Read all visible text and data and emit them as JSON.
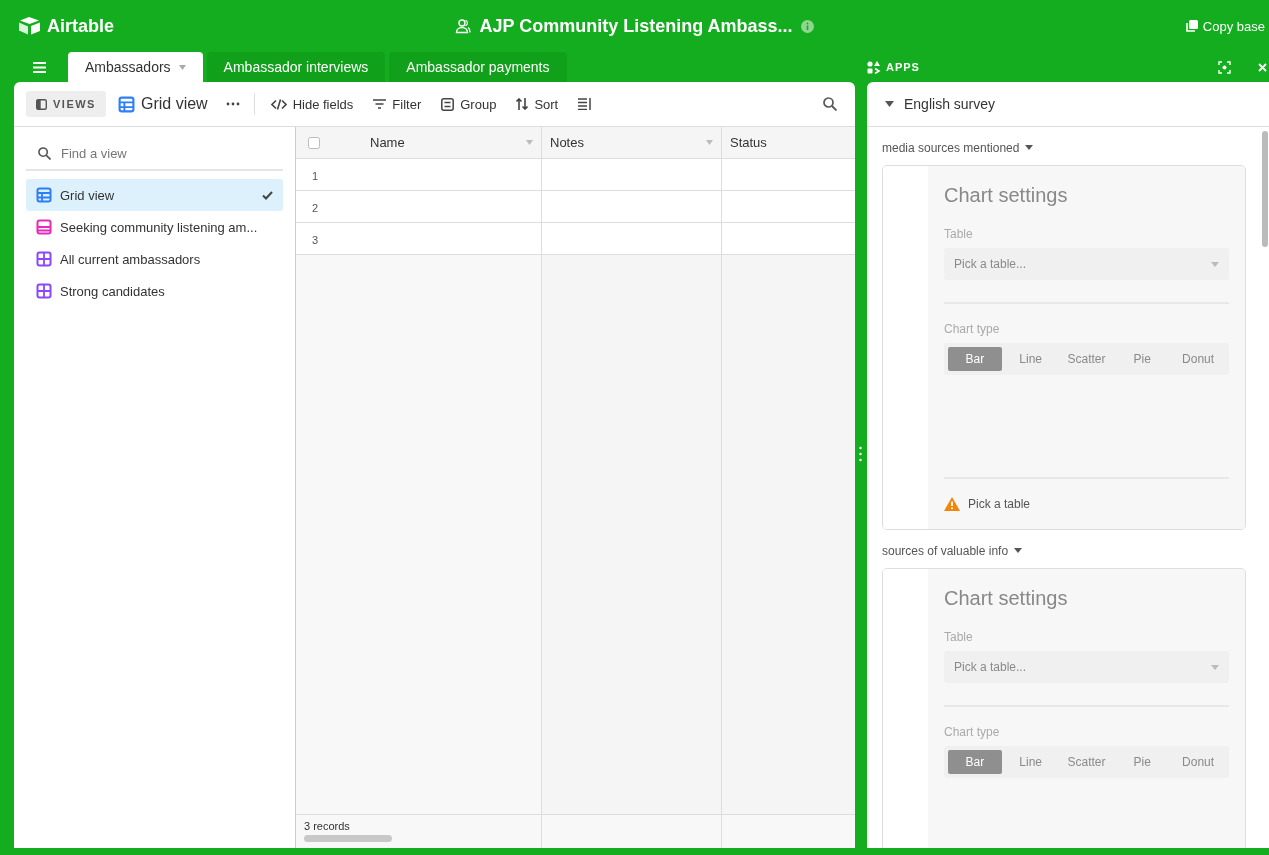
{
  "topbar": {
    "logo": "Airtable",
    "base_title": "AJP Community Listening Ambass...",
    "copy_button": "Copy base"
  },
  "tabs": [
    {
      "label": "Ambassadors",
      "selected": true
    },
    {
      "label": "Ambassador interviews",
      "selected": false
    },
    {
      "label": "Ambassador payments",
      "selected": false
    }
  ],
  "toolbar": {
    "views_button": "VIEWS",
    "current_view": "Grid view",
    "hide_fields": "Hide fields",
    "filter": "Filter",
    "group": "Group",
    "sort": "Sort"
  },
  "sidebar": {
    "search": {
      "placeholder": "Find a view"
    },
    "views": [
      {
        "label": "Grid view",
        "kind": "grid",
        "color": "#2d7ff9",
        "selected": true
      },
      {
        "label": "Seeking community listening am...",
        "kind": "form",
        "color": "#e929ba",
        "selected": false
      },
      {
        "label": "All current ambassadors",
        "kind": "gallery",
        "color": "#8b46ff",
        "selected": false
      },
      {
        "label": "Strong candidates",
        "kind": "gallery",
        "color": "#8b46ff",
        "selected": false
      }
    ]
  },
  "grid": {
    "columns": [
      {
        "name": "Name"
      },
      {
        "name": "Notes"
      },
      {
        "name": "Status"
      }
    ],
    "rows": [
      {
        "number": "1"
      },
      {
        "number": "2"
      },
      {
        "number": "3"
      }
    ],
    "footer": "3 records"
  },
  "apps_panel": {
    "title": "APPS",
    "app_name": "English survey",
    "blocks": [
      {
        "title": "media sources mentioned",
        "heading": "Chart settings",
        "table_label": "Table",
        "table_placeholder": "Pick a table...",
        "type_label": "Chart type",
        "chart_types": [
          {
            "label": "Bar",
            "selected": true
          },
          {
            "label": "Line",
            "selected": false
          },
          {
            "label": "Scatter",
            "selected": false
          },
          {
            "label": "Pie",
            "selected": false
          },
          {
            "label": "Donut",
            "selected": false
          }
        ],
        "warning": "Pick a table"
      },
      {
        "title": "sources of valuable info",
        "heading": "Chart settings",
        "table_label": "Table",
        "table_placeholder": "Pick a table...",
        "type_label": "Chart type",
        "chart_types": [
          {
            "label": "Bar",
            "selected": true
          },
          {
            "label": "Line",
            "selected": false
          },
          {
            "label": "Scatter",
            "selected": false
          },
          {
            "label": "Pie",
            "selected": false
          },
          {
            "label": "Donut",
            "selected": false
          }
        ]
      }
    ]
  }
}
